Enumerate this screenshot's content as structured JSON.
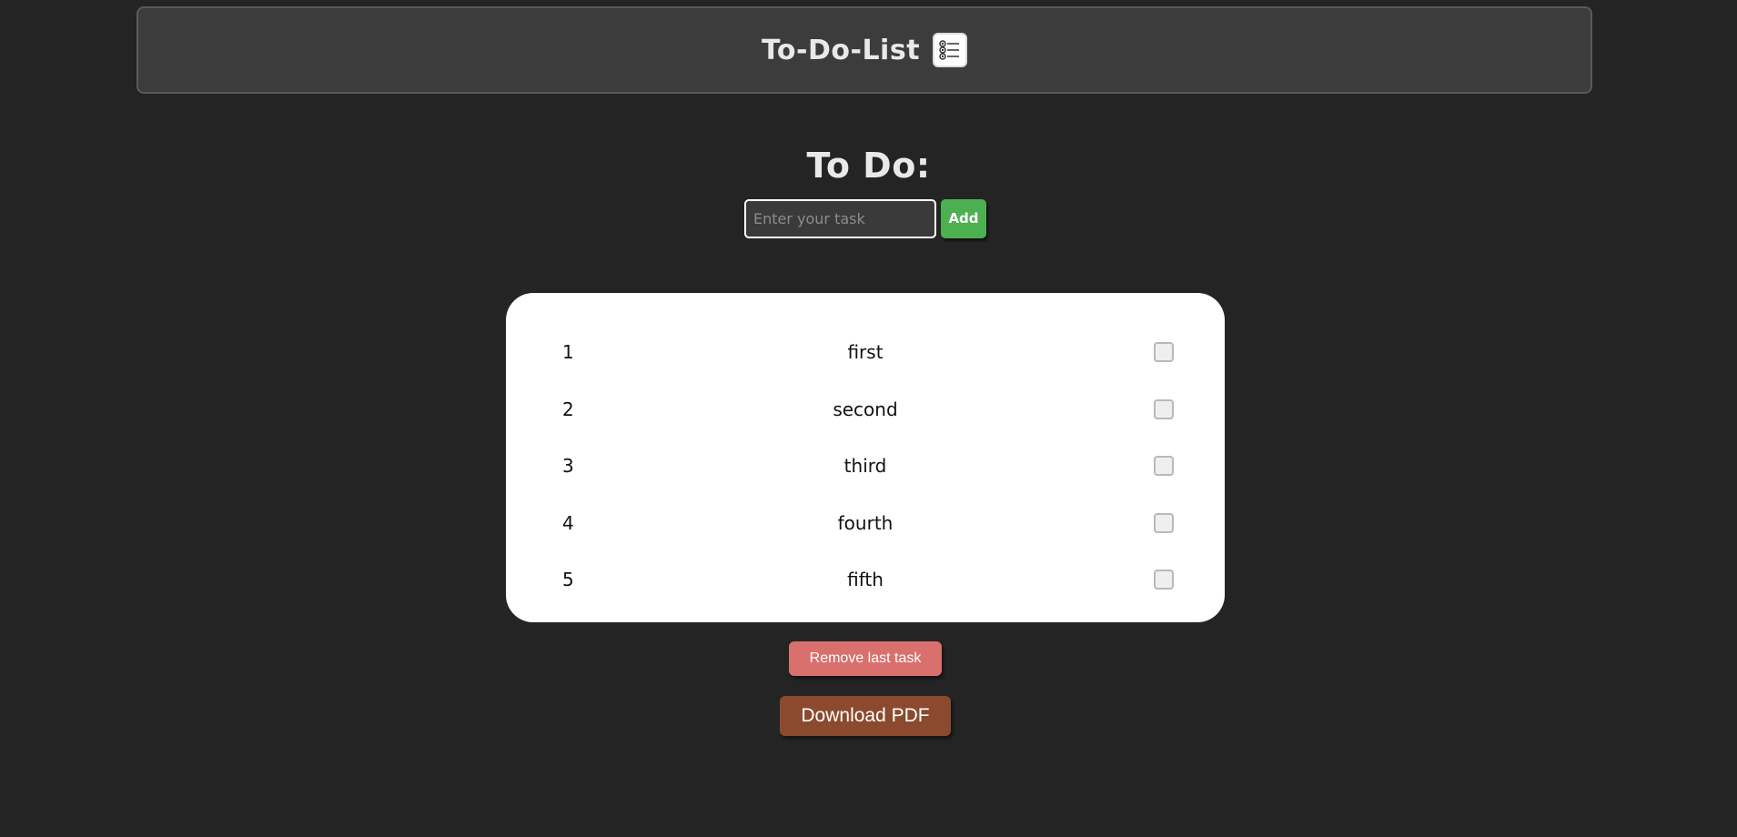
{
  "header": {
    "title": "To-Do-List",
    "icon": "list-icon"
  },
  "main": {
    "heading": "To Do:",
    "input": {
      "placeholder": "Enter your task",
      "value": ""
    },
    "add_label": "Add"
  },
  "tasks": [
    {
      "number": "1",
      "text": "first",
      "checked": false
    },
    {
      "number": "2",
      "text": "second",
      "checked": false
    },
    {
      "number": "3",
      "text": "third",
      "checked": false
    },
    {
      "number": "4",
      "text": "fourth",
      "checked": false
    },
    {
      "number": "5",
      "text": "fifth",
      "checked": false
    }
  ],
  "actions": {
    "remove_label": "Remove last task",
    "download_label": "Download PDF"
  },
  "colors": {
    "background": "#242424",
    "header_bg": "#3c3c3c",
    "add_button": "#4caf50",
    "remove_button": "#d9706e",
    "download_button": "#8b4a2e"
  }
}
